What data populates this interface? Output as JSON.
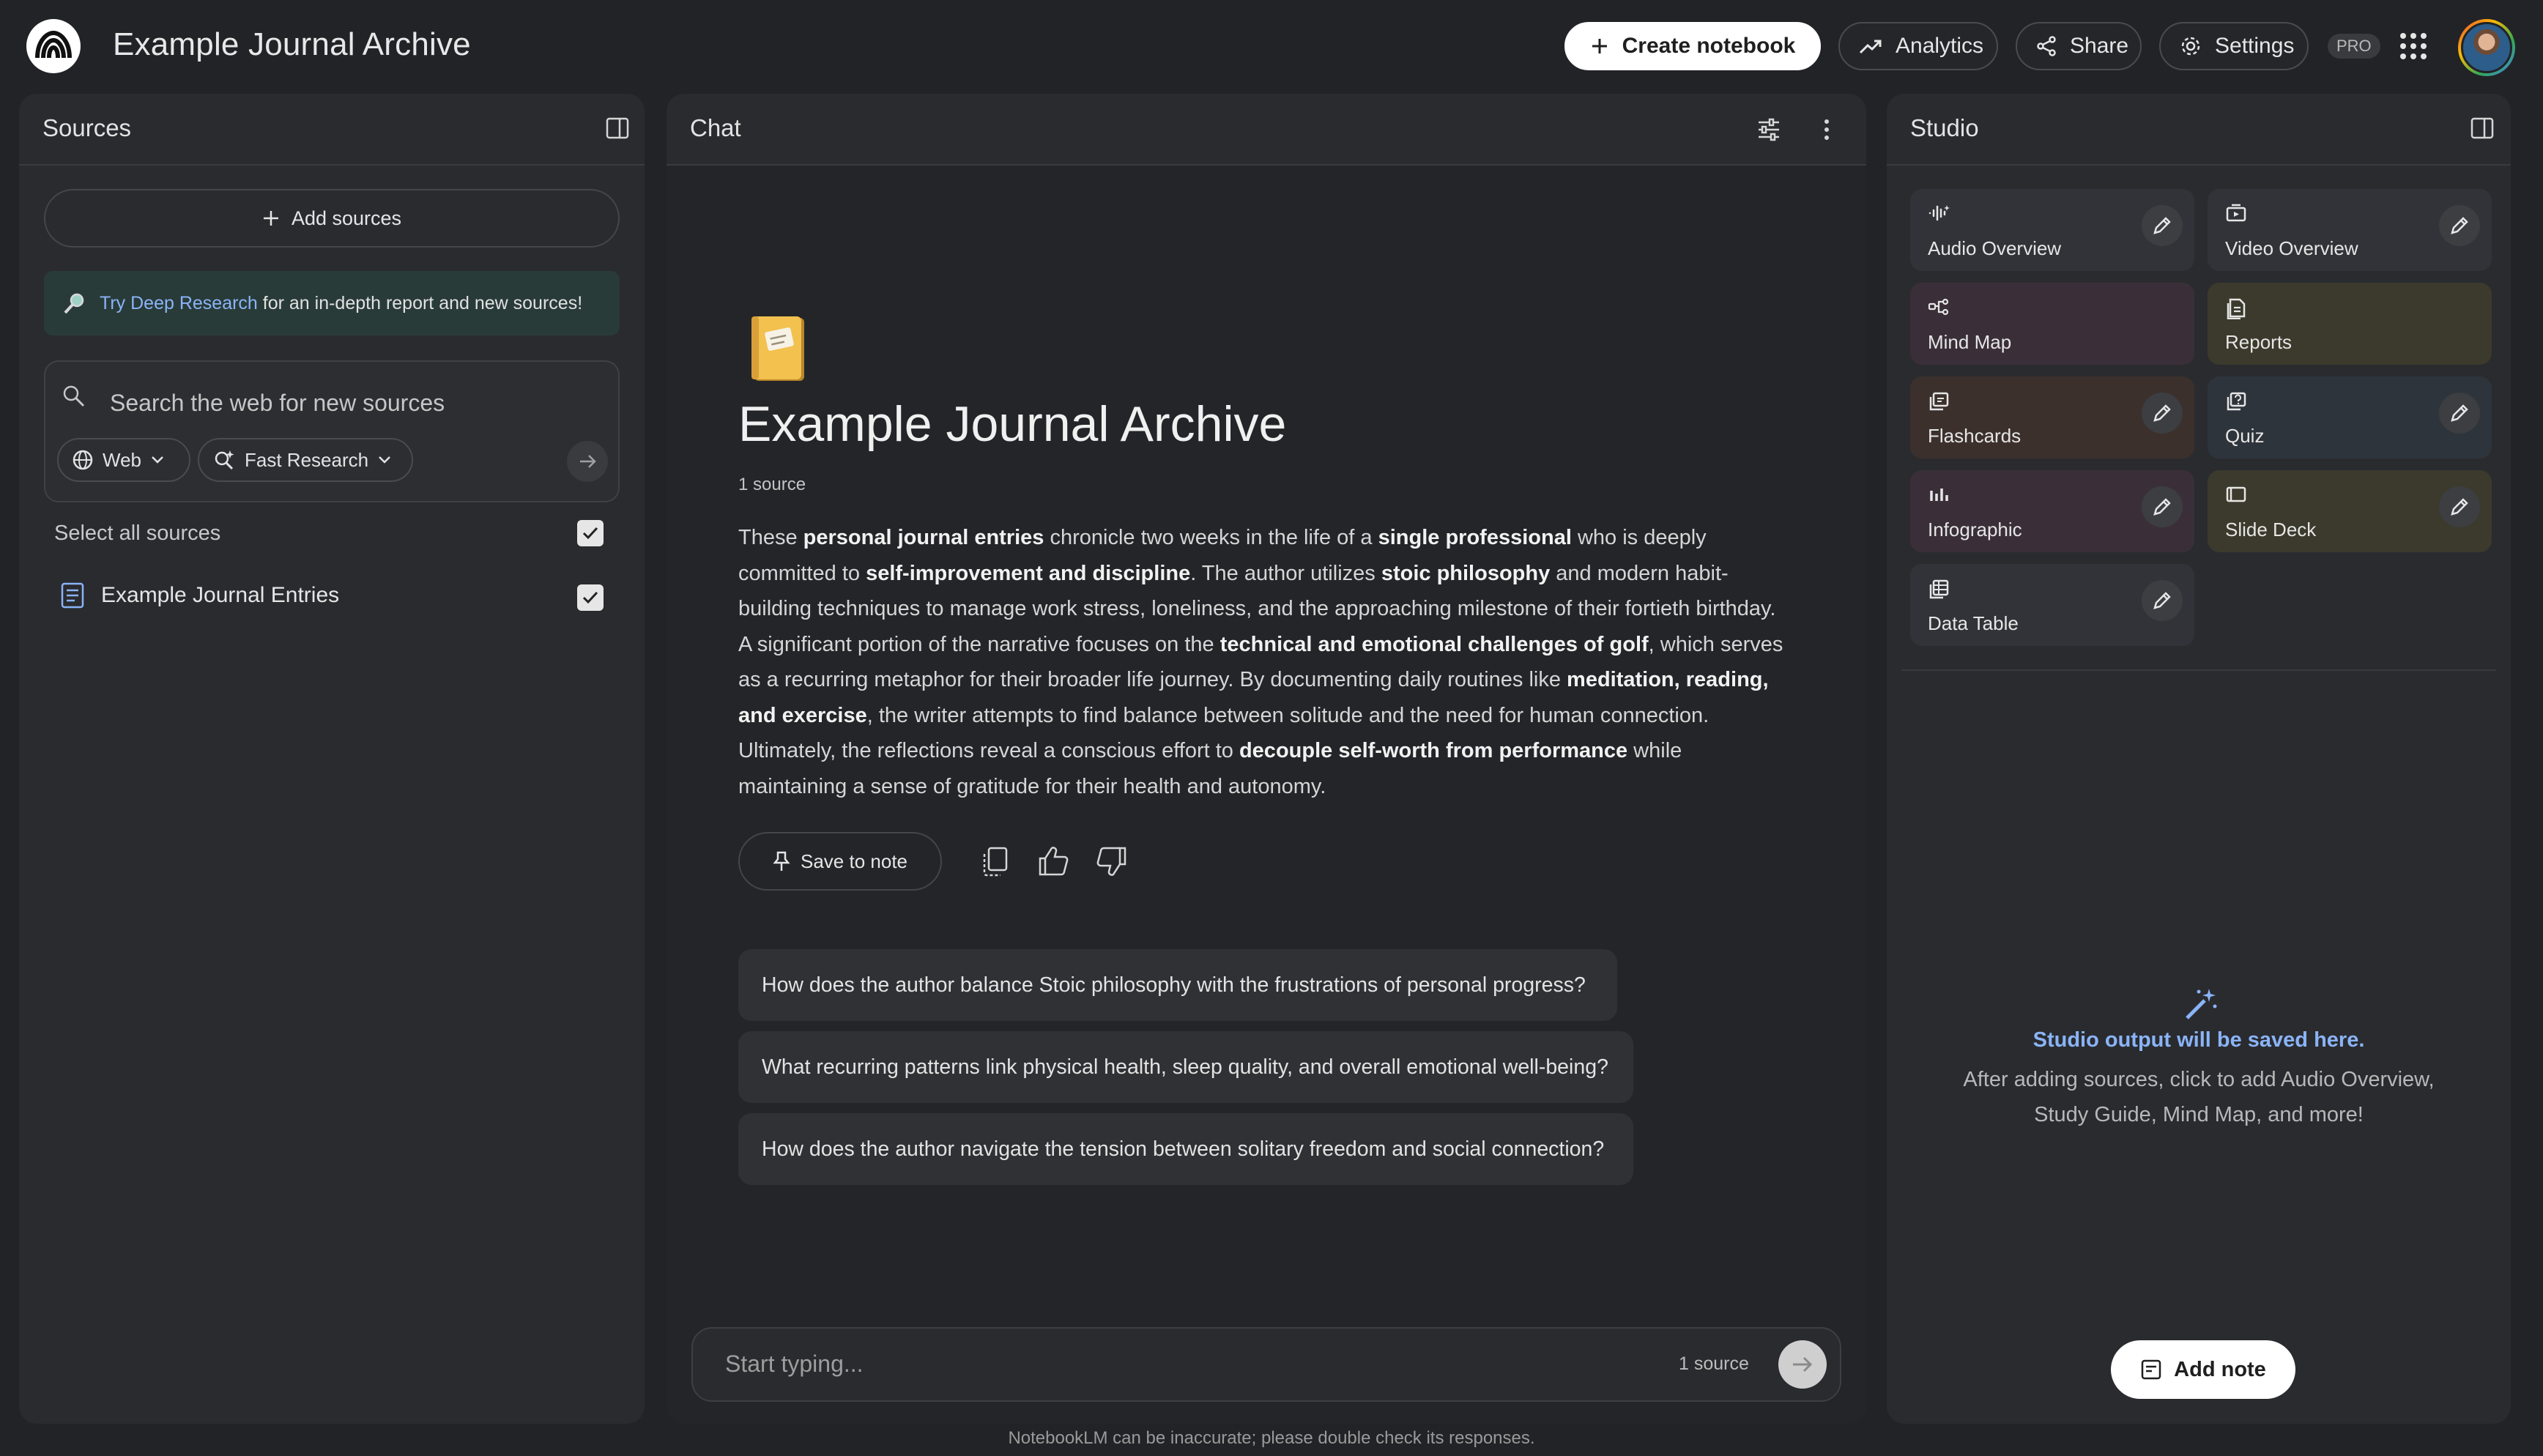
{
  "app": {
    "title": "Example Journal Archive"
  },
  "topbar": {
    "create_label": "Create notebook",
    "analytics_label": "Analytics",
    "share_label": "Share",
    "settings_label": "Settings",
    "pro_badge": "PRO"
  },
  "sources": {
    "title": "Sources",
    "add_label": "Add sources",
    "deep_research_link": "Try Deep Research",
    "deep_research_rest": " for an in-depth report and new sources!",
    "search_placeholder": "Search the web for new sources",
    "web_label": "Web",
    "research_label": "Fast Research",
    "select_all_label": "Select all sources",
    "items": [
      {
        "label": "Example Journal Entries",
        "checked": true
      }
    ]
  },
  "chat": {
    "title": "Chat",
    "notebook_title": "Example Journal Archive",
    "source_count": "1 source",
    "summary_parts": [
      {
        "t": "These ",
        "b": false
      },
      {
        "t": "personal journal entries",
        "b": true
      },
      {
        "t": " chronicle two weeks in the life of a ",
        "b": false
      },
      {
        "t": "single professional",
        "b": true
      },
      {
        "t": " who is deeply committed to ",
        "b": false
      },
      {
        "t": "self-improvement and discipline",
        "b": true
      },
      {
        "t": ". The author utilizes ",
        "b": false
      },
      {
        "t": "stoic philosophy",
        "b": true
      },
      {
        "t": " and modern habit-building techniques to manage work stress, loneliness, and the approaching milestone of their fortieth birthday. A significant portion of the narrative focuses on the ",
        "b": false
      },
      {
        "t": "technical and emotional challenges of golf",
        "b": true
      },
      {
        "t": ", which serves as a recurring metaphor for their broader life journey. By documenting daily routines like ",
        "b": false
      },
      {
        "t": "meditation, reading, and exercise",
        "b": true
      },
      {
        "t": ", the writer attempts to find balance between solitude and the need for human connection. Ultimately, the reflections reveal a conscious effort to ",
        "b": false
      },
      {
        "t": "decouple self-worth from performance",
        "b": true
      },
      {
        "t": " while maintaining a sense of gratitude for their health and autonomy.",
        "b": false
      }
    ],
    "save_note_label": "Save to note",
    "suggestions": [
      "How does the author balance Stoic philosophy with the frustrations of personal progress?",
      "What recurring patterns link physical health, sleep quality, and overall emotional well-being?",
      "How does the author navigate the tension between solitary freedom and social connection?"
    ],
    "input_placeholder": "Start typing...",
    "input_source_count": "1 source",
    "disclaimer": "NotebookLM can be inaccurate; please double check its responses."
  },
  "studio": {
    "title": "Studio",
    "tiles": [
      {
        "label": "Audio Overview",
        "icon": "audio-wave-icon",
        "color": "#313338",
        "editable": true
      },
      {
        "label": "Video Overview",
        "icon": "video-icon",
        "color": "#313338",
        "editable": true
      },
      {
        "label": "Mind Map",
        "icon": "mind-map-icon",
        "color": "#3a2f39",
        "editable": false
      },
      {
        "label": "Reports",
        "icon": "reports-icon",
        "color": "#3b3a2c",
        "editable": false
      },
      {
        "label": "Flashcards",
        "icon": "flashcards-icon",
        "color": "#3b302c",
        "editable": true
      },
      {
        "label": "Quiz",
        "icon": "quiz-icon",
        "color": "#2e343b",
        "editable": true
      },
      {
        "label": "Infographic",
        "icon": "infographic-icon",
        "color": "#3a2f39",
        "editable": true
      },
      {
        "label": "Slide Deck",
        "icon": "slide-deck-icon",
        "color": "#3b3a2c",
        "editable": true
      },
      {
        "label": "Data Table",
        "icon": "data-table-icon",
        "color": "#313338",
        "editable": true
      }
    ],
    "empty_title": "Studio output will be saved here.",
    "empty_text": "After adding sources, click to add Audio Overview, Study Guide, Mind Map, and more!",
    "add_note_label": "Add note"
  },
  "colors": {
    "accent": "#8ab4f8",
    "panel": "#2a2b2f",
    "background": "#222326"
  }
}
